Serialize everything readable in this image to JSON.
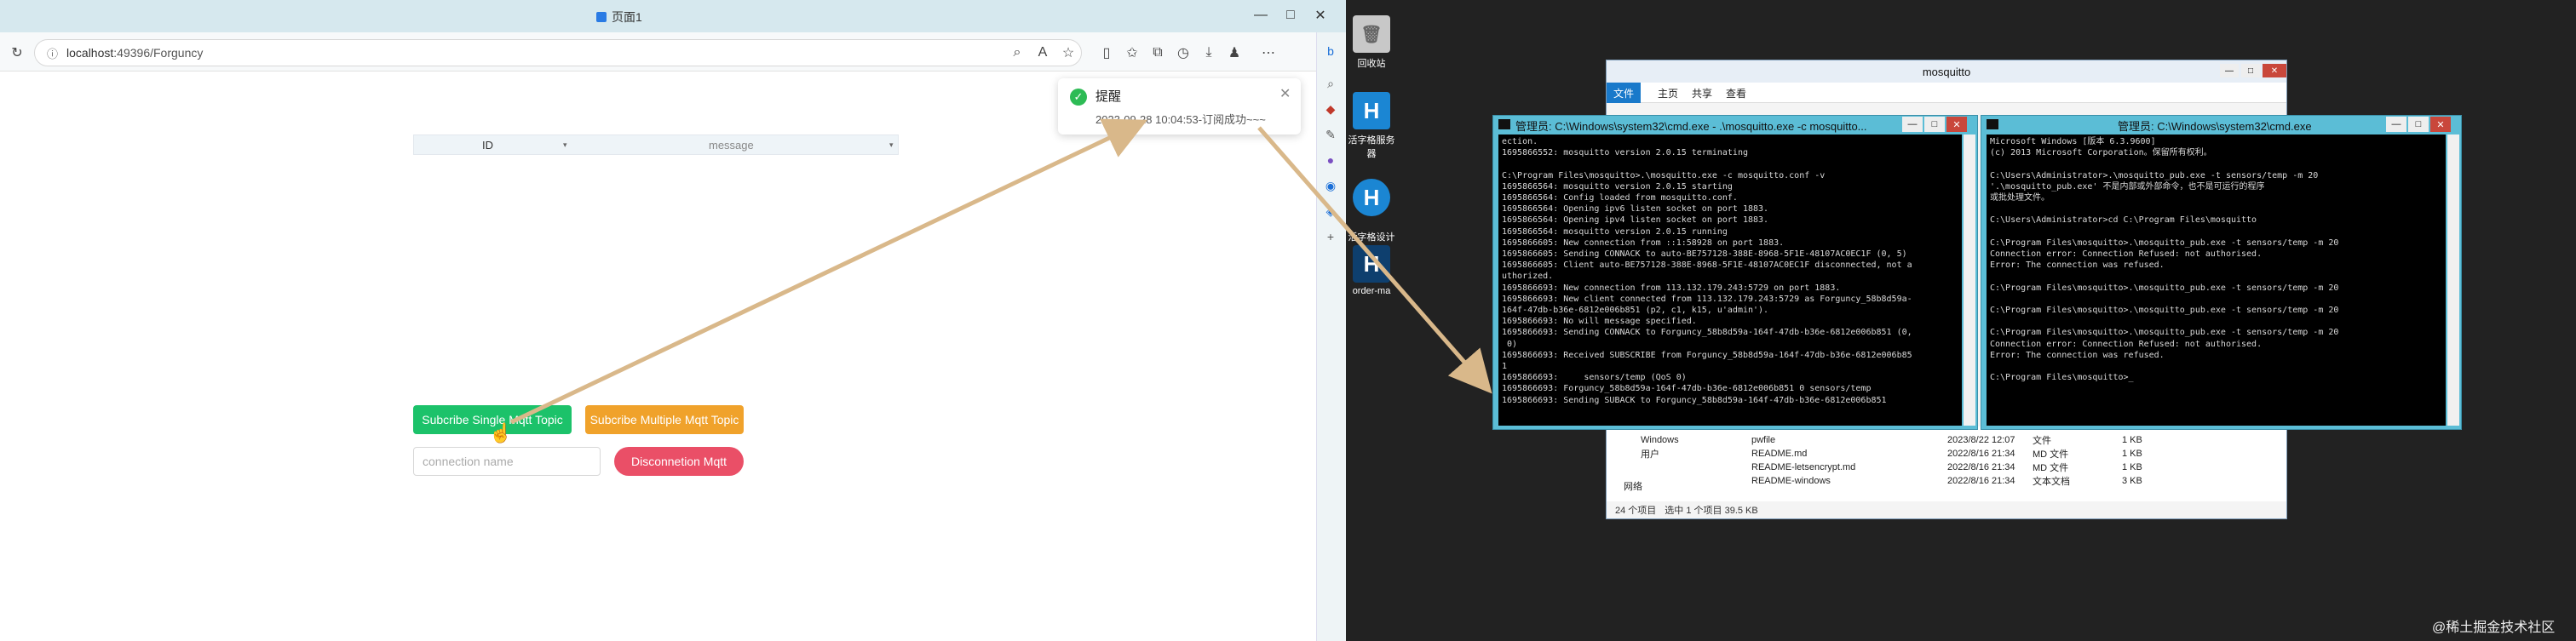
{
  "browser": {
    "tab_title": "页面1",
    "url_host": "localhost",
    "url_rest": ":49396/Forguncy",
    "window_controls": [
      "—",
      "□",
      "✕"
    ],
    "toolbar_icons": [
      "zoom-icon",
      "read-aloud-icon",
      "favorite-icon",
      "split-icon",
      "favorites-icon",
      "collections-icon",
      "history-icon",
      "download-icon",
      "extensions-icon",
      "menu-icon"
    ]
  },
  "grid": {
    "col_id": "ID",
    "col_message": "message"
  },
  "buttons": {
    "subscribe_single": "Subcribe Single Mqtt Topic",
    "subscribe_multiple": "Subcribe Multiple Mqtt Topic",
    "disconnect": "Disconnetion Mqtt"
  },
  "connection_input": {
    "placeholder": "connection name"
  },
  "toast": {
    "title": "提醒",
    "message": "2023-09-28 10:04:53-订阅成功~~~"
  },
  "desktop": {
    "icons": [
      {
        "label": "回收站",
        "icon": "recycle-bin-icon"
      },
      {
        "label": "活字格服务器",
        "icon": "server-icon"
      },
      {
        "label": "活字格设计器\n9",
        "icon": "designer-icon"
      },
      {
        "label": "order-ma",
        "icon": "app-icon"
      }
    ]
  },
  "explorer": {
    "title": "mosquitto",
    "menus": [
      "文件",
      "主页",
      "共享",
      "查看"
    ],
    "tree": [
      "Windows",
      "用户",
      "网络"
    ],
    "files": [
      {
        "name": "pwfile",
        "date": "2023/8/22 12:07",
        "type": "文件",
        "size": "1 KB"
      },
      {
        "name": "README.md",
        "date": "2022/8/16 21:34",
        "type": "MD 文件",
        "size": "1 KB"
      },
      {
        "name": "README-letsencrypt.md",
        "date": "2022/8/16 21:34",
        "type": "MD 文件",
        "size": "1 KB"
      },
      {
        "name": "README-windows",
        "date": "2022/8/16 21:34",
        "type": "文本文档",
        "size": "3 KB"
      }
    ],
    "status": [
      "24 个项目",
      "选中 1 个项目 39.5 KB"
    ]
  },
  "cmd1": {
    "title": "管理员: C:\\Windows\\system32\\cmd.exe - .\\mosquitto.exe -c mosquitto...",
    "lines": [
      "ection.",
      "1695866552: mosquitto version 2.0.15 terminating",
      "",
      "C:\\Program Files\\mosquitto>.\\mosquitto.exe -c mosquitto.conf -v",
      "1695866564: mosquitto version 2.0.15 starting",
      "1695866564: Config loaded from mosquitto.conf.",
      "1695866564: Opening ipv6 listen socket on port 1883.",
      "1695866564: Opening ipv4 listen socket on port 1883.",
      "1695866564: mosquitto version 2.0.15 running",
      "1695866605: New connection from ::1:58928 on port 1883.",
      "1695866605: Sending CONNACK to auto-BE757128-388E-8968-5F1E-48107AC0EC1F (0, 5)",
      "1695866605: Client auto-BE757128-388E-8968-5F1E-48107AC0EC1F disconnected, not a",
      "uthorized.",
      "1695866693: New connection from 113.132.179.243:5729 on port 1883.",
      "1695866693: New client connected from 113.132.179.243:5729 as Forguncy_58b8d59a-",
      "164f-47db-b36e-6812e006b851 (p2, c1, k15, u'admin').",
      "1695866693: No will message specified.",
      "1695866693: Sending CONNACK to Forguncy_58b8d59a-164f-47db-b36e-6812e006b851 (0,",
      " 0)",
      "1695866693: Received SUBSCRIBE from Forguncy_58b8d59a-164f-47db-b36e-6812e006b85",
      "1",
      "1695866693:     sensors/temp (QoS 0)",
      "1695866693: Forguncy_58b8d59a-164f-47db-b36e-6812e006b851 0 sensors/temp",
      "1695866693: Sending SUBACK to Forguncy_58b8d59a-164f-47db-b36e-6812e006b851"
    ]
  },
  "cmd2": {
    "title": "管理员: C:\\Windows\\system32\\cmd.exe",
    "lines": [
      "Microsoft Windows [版本 6.3.9600]",
      "(c) 2013 Microsoft Corporation。保留所有权利。",
      "",
      "C:\\Users\\Administrator>.\\mosquitto_pub.exe -t sensors/temp -m 20",
      "'.\\mosquitto_pub.exe' 不是内部或外部命令，也不是可运行的程序",
      "或批处理文件。",
      "",
      "C:\\Users\\Administrator>cd C:\\Program Files\\mosquitto",
      "",
      "C:\\Program Files\\mosquitto>.\\mosquitto_pub.exe -t sensors/temp -m 20",
      "Connection error: Connection Refused: not authorised.",
      "Error: The connection was refused.",
      "",
      "C:\\Program Files\\mosquitto>.\\mosquitto_pub.exe -t sensors/temp -m 20",
      "",
      "C:\\Program Files\\mosquitto>.\\mosquitto_pub.exe -t sensors/temp -m 20",
      "",
      "C:\\Program Files\\mosquitto>.\\mosquitto_pub.exe -t sensors/temp -m 20",
      "Connection error: Connection Refused: not authorised.",
      "Error: The connection was refused.",
      "",
      "C:\\Program Files\\mosquitto>_"
    ]
  },
  "watermark": "@稀土掘金技术社区",
  "colors": {
    "green_button": "#1cc26a",
    "orange_button": "#f0a22b",
    "red_button": "#ea4f67",
    "arrow": "#d9b88a",
    "cmd_frame": "#5bbdd6"
  }
}
